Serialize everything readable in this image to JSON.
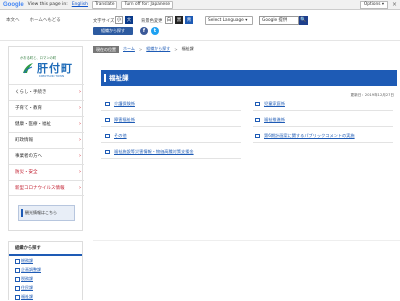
{
  "translate_bar": {
    "logo": "Google",
    "view_text": "View this page in:",
    "language": "English",
    "translate_label": "Translate",
    "turn_off_label": "Turn off for: Japanese",
    "options_label": "Options ▾",
    "close_glyph": "×"
  },
  "util": {
    "links": [
      "本文へ",
      "ホームへもどる"
    ],
    "text_size_label": "文字サイズ",
    "text_size_small": "小",
    "text_size_large": "大",
    "bg_color_label": "背景色変更",
    "bg_white": "白",
    "bg_black": "黒",
    "bg_blue": "青",
    "select_language": "Select Language ▾",
    "search_placeholder": "Google 提供",
    "search_glyph": "🔍",
    "bookmark_label": "組織から探す",
    "social_f": "f",
    "social_t": "t"
  },
  "logo": {
    "tagline": "かおる町と、ロマンの町",
    "name": "肝付町",
    "romaji": "KIMOTSUKI TOWN"
  },
  "sidebar": {
    "items": [
      {
        "label": "くらし・手続き"
      },
      {
        "label": "子育て・教育"
      },
      {
        "label": "健康・医療・福祉"
      },
      {
        "label": "町政情報"
      },
      {
        "label": "事業者の方へ"
      },
      {
        "label": "防災・安全"
      },
      {
        "label": "新型コロナウイルス情報"
      }
    ],
    "chevron": "›",
    "note": "観光情報はこちら"
  },
  "breadcrumb": {
    "here": "現在の位置",
    "items": [
      "ホーム",
      "組織から探す",
      "福祉課"
    ],
    "sep": ">"
  },
  "main": {
    "title": "福祉課",
    "updated": "更新日：2019年12月27日",
    "links_left": [
      "介護保険係",
      "障害福祉係",
      "その他",
      "福祉施設等災害情報・物価高騰対策支援金"
    ],
    "links_right": [
      "児童家庭係",
      "福祉推進係",
      "第6期計画案に関するパブリックコメントの実施"
    ]
  },
  "lower": {
    "head": "組織から探す",
    "items": [
      "総務課",
      "企画調整課",
      "税務課",
      "住民課",
      "福祉課"
    ]
  },
  "colors": {
    "accent": "#1e5bb5",
    "alert": "#c0182a",
    "brand_green": "#2d7a3a"
  }
}
